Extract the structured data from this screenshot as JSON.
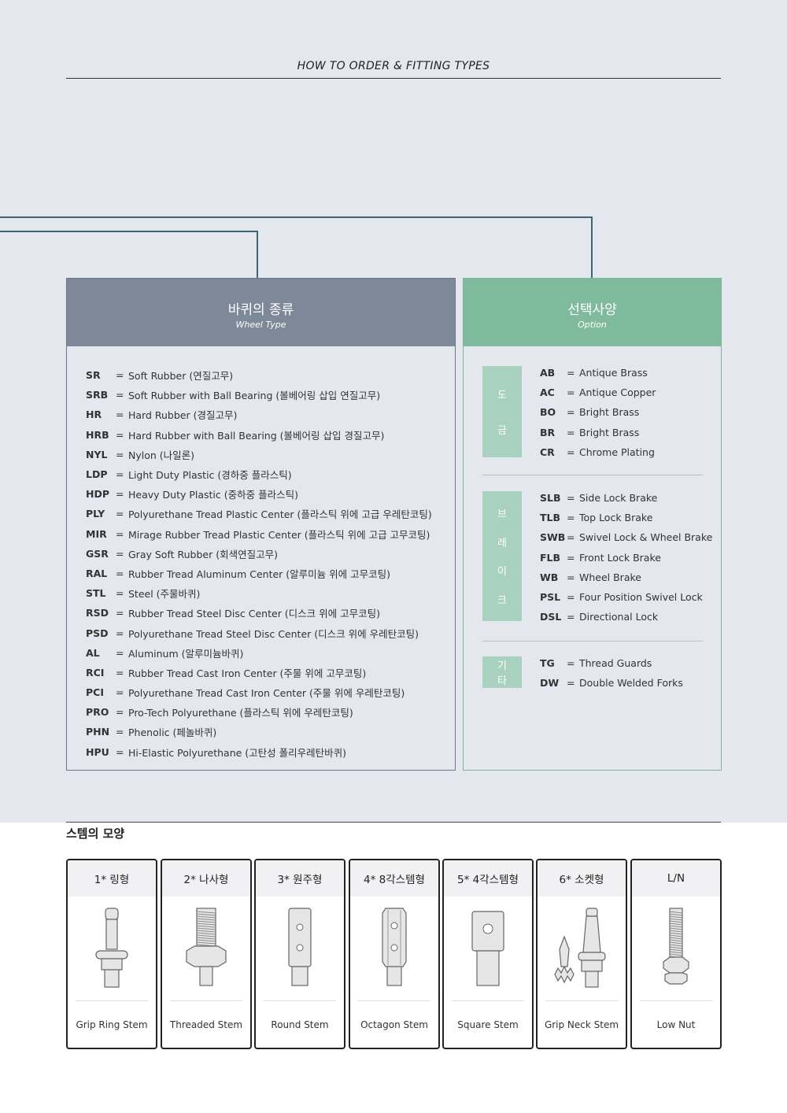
{
  "header": {
    "title": "HOW TO ORDER & FITTING TYPES"
  },
  "wheel_type": {
    "title_ko": "바퀴의 종류",
    "title_en": "Wheel Type",
    "items": [
      {
        "code": "SR",
        "desc": "Soft Rubber (연질고무)"
      },
      {
        "code": "SRB",
        "desc": "Soft Rubber with Ball Bearing (볼베어링 삽입 연질고무)"
      },
      {
        "code": "HR",
        "desc": "Hard Rubber (경질고무)"
      },
      {
        "code": "HRB",
        "desc": "Hard Rubber with Ball Bearing (볼베어링 삽입 경질고무)"
      },
      {
        "code": "NYL",
        "desc": "Nylon (나일론)"
      },
      {
        "code": "LDP",
        "desc": "Light Duty Plastic (경하중 플라스틱)"
      },
      {
        "code": "HDP",
        "desc": "Heavy Duty Plastic (중하중 플라스틱)"
      },
      {
        "code": "PLY",
        "desc": "Polyurethane Tread Plastic Center (플라스틱 위에 고급 우레탄코팅)"
      },
      {
        "code": "MIR",
        "desc": "Mirage Rubber Tread Plastic Center (플라스틱 위에 고급 고무코팅)"
      },
      {
        "code": "GSR",
        "desc": "Gray Soft Rubber (회색연질고무)"
      },
      {
        "code": "RAL",
        "desc": "Rubber Tread Aluminum Center (알루미늄 위에 고무코팅)"
      },
      {
        "code": "STL",
        "desc": "Steel (주물바퀴)"
      },
      {
        "code": "RSD",
        "desc": "Rubber Tread Steel Disc Center (디스크 위에 고무코팅)"
      },
      {
        "code": "PSD",
        "desc": "Polyurethane Tread Steel Disc Center (디스크 위에 우레탄코팅)"
      },
      {
        "code": "AL",
        "desc": "Aluminum (알루미늄바퀴)"
      },
      {
        "code": "RCI",
        "desc": "Rubber Tread Cast Iron Center (주물 위에 고무코팅)"
      },
      {
        "code": "PCI",
        "desc": "Polyurethane Tread Cast Iron Center (주물 위에 우레탄코팅)"
      },
      {
        "code": "PRO",
        "desc": "Pro-Tech Polyurethane (플라스틱 위에 우레탄코팅)"
      },
      {
        "code": "PHN",
        "desc": "Phenolic (페놀바퀴)"
      },
      {
        "code": "HPU",
        "desc": "Hi-Elastic Polyurethane (고탄성 폴리우레탄바퀴)"
      }
    ]
  },
  "option": {
    "title_ko": "선택사양",
    "title_en": "Option",
    "groups": [
      {
        "tag": [
          "도",
          "금"
        ],
        "items": [
          {
            "code": "AB",
            "desc": "Antique Brass"
          },
          {
            "code": "AC",
            "desc": "Antique Copper"
          },
          {
            "code": "BO",
            "desc": "Bright Brass"
          },
          {
            "code": "BR",
            "desc": "Bright Brass"
          },
          {
            "code": "CR",
            "desc": "Chrome Plating"
          }
        ]
      },
      {
        "tag": [
          "브",
          "레",
          "이",
          "크"
        ],
        "items": [
          {
            "code": "SLB",
            "desc": "Side Lock Brake"
          },
          {
            "code": "TLB",
            "desc": "Top Lock Brake"
          },
          {
            "code": "SWB",
            "desc": "Swivel Lock & Wheel Brake"
          },
          {
            "code": "FLB",
            "desc": "Front Lock Brake"
          },
          {
            "code": "WB",
            "desc": "Wheel Brake"
          },
          {
            "code": "PSL",
            "desc": "Four Position Swivel Lock"
          },
          {
            "code": "DSL",
            "desc": "Directional Lock"
          }
        ]
      },
      {
        "tag": [
          "기",
          "타"
        ],
        "items": [
          {
            "code": "TG",
            "desc": "Thread Guards"
          },
          {
            "code": "DW",
            "desc": "Double  Welded Forks"
          }
        ]
      }
    ]
  },
  "stems": {
    "heading": "스템의 모양",
    "items": [
      {
        "title": "1* 링형",
        "label": "Grip Ring Stem",
        "icon": "grip-ring-stem-icon"
      },
      {
        "title": "2* 나사형",
        "label": "Threaded Stem",
        "icon": "threaded-stem-icon"
      },
      {
        "title": "3* 원주형",
        "label": "Round Stem",
        "icon": "round-stem-icon"
      },
      {
        "title": "4* 8각스템형",
        "label": "Octagon Stem",
        "icon": "octagon-stem-icon"
      },
      {
        "title": "5* 4각스템형",
        "label": "Square Stem",
        "icon": "square-stem-icon"
      },
      {
        "title": "6* 소켓형",
        "label": "Grip Neck Stem",
        "icon": "grip-neck-stem-icon"
      },
      {
        "title": "L/N",
        "label": "Low Nut",
        "icon": "low-nut-icon"
      }
    ]
  },
  "colors": {
    "background": "#e4e7ee",
    "wheel_header": "#7d8898",
    "option_header": "#7fba9d",
    "option_tag": "#a8d1bf",
    "connector": "#3e6476"
  }
}
